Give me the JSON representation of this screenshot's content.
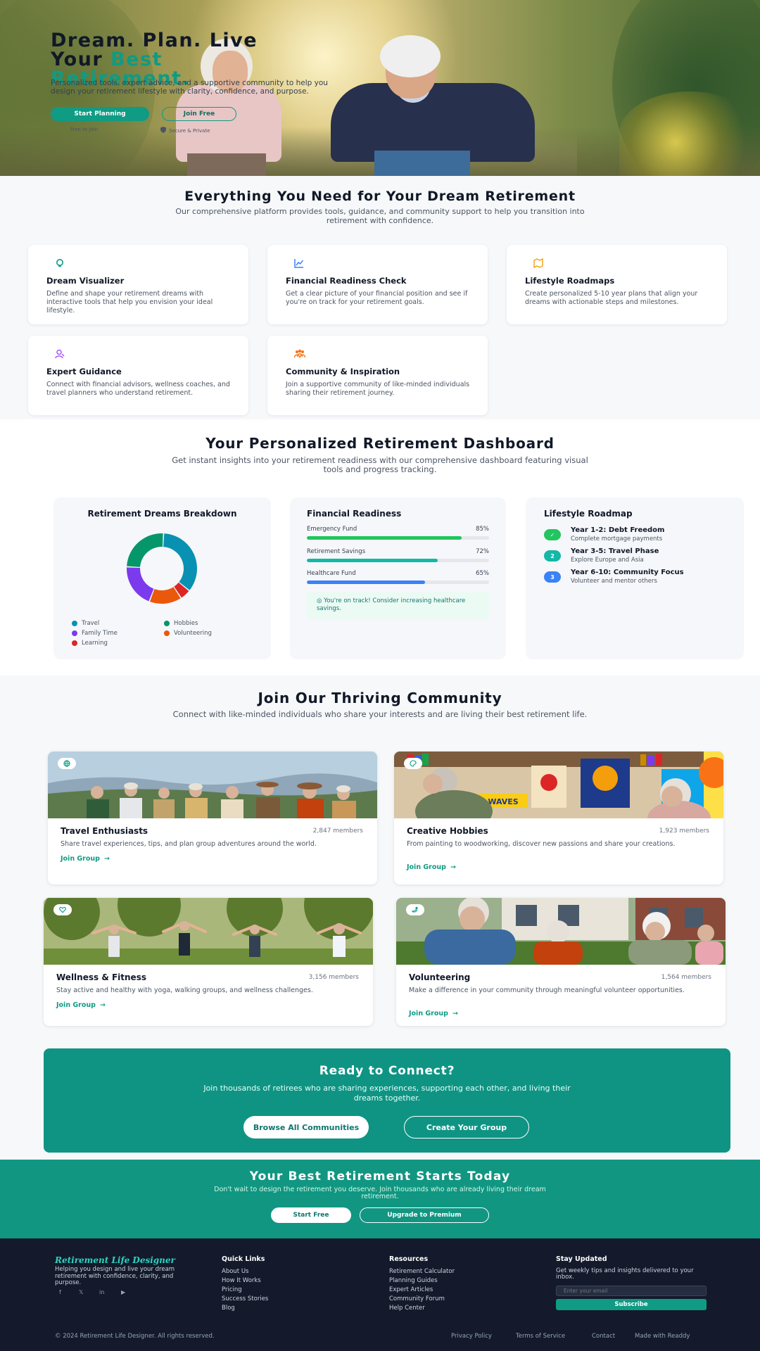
{
  "hero": {
    "title_line1": "Dream. Plan. Live",
    "title_line2_prefix": "Your ",
    "title_line2_accent": "Best",
    "title_line3_accent": "Retirement.",
    "subtitle": "Personalized tools, expert advice, and a supportive community to help you design your retirement lifestyle with clarity, confidence, and purpose.",
    "primary_button": "Start Planning",
    "secondary_button": "Join Free",
    "trust_left": "Free to Join",
    "trust_right": "Secure & Private",
    "colors": {
      "accent": "#0f9b84"
    }
  },
  "features": {
    "title": "Everything You Need for Your Dream Retirement",
    "subtitle": "Our comprehensive platform provides tools, guidance, and community support to help you transition into retirement with confidence.",
    "cards": [
      {
        "title": "Dream Visualizer",
        "desc": "Define and shape your retirement dreams with interactive tools that help you envision your ideal lifestyle.",
        "icon": "lightbulb-icon",
        "icon_color": "#0f9b84"
      },
      {
        "title": "Financial Readiness Check",
        "desc": "Get a clear picture of your financial position and see if you're on track for your retirement goals.",
        "icon": "chart-line-icon",
        "icon_color": "#3b82f6"
      },
      {
        "title": "Lifestyle Roadmaps",
        "desc": "Create personalized 5-10 year plans that align your dreams with actionable steps and milestones.",
        "icon": "map-icon",
        "icon_color": "#f59e0b"
      },
      {
        "title": "Expert Guidance",
        "desc": "Connect with financial advisors, wellness coaches, and travel planners who understand retirement.",
        "icon": "user-tie-icon",
        "icon_color": "#a855f7"
      },
      {
        "title": "Community & Inspiration",
        "desc": "Join a supportive community of like-minded individuals sharing their retirement journey.",
        "icon": "people-icon",
        "icon_color": "#f97316"
      }
    ]
  },
  "dashboard": {
    "title": "Your Personalized Retirement Dashboard",
    "subtitle": "Get instant insights into your retirement readiness with our comprehensive dashboard featuring visual tools and progress tracking.",
    "dreams_card": {
      "title": "Retirement Dreams Breakdown"
    },
    "finance_card": {
      "title": "Financial Readiness",
      "bars": [
        {
          "label": "Emergency Fund",
          "value": 85,
          "display": "85%",
          "color": "#22c55e"
        },
        {
          "label": "Retirement Savings",
          "value": 72,
          "display": "72%",
          "color": "#14b8a6"
        },
        {
          "label": "Healthcare Fund",
          "value": 65,
          "display": "65%",
          "color": "#3b82f6"
        }
      ],
      "status": "You're on track! Consider increasing healthcare savings."
    },
    "roadmap_card": {
      "title": "Lifestyle Roadmap",
      "items": [
        {
          "badge": "✓",
          "title": "Year 1-2: Debt Freedom",
          "sub": "Complete mortgage payments",
          "color": "#22c55e"
        },
        {
          "badge": "2",
          "title": "Year 3-5: Travel Phase",
          "sub": "Explore Europe and Asia",
          "color": "#14b8a6"
        },
        {
          "badge": "3",
          "title": "Year 6-10: Community Focus",
          "sub": "Volunteer and mentor others",
          "color": "#3b82f6"
        }
      ]
    }
  },
  "chart_data": {
    "type": "pie",
    "donut": true,
    "title": "Retirement Dreams Breakdown",
    "categories": [
      "Travel",
      "Learning",
      "Volunteering",
      "Family Time",
      "Hobbies"
    ],
    "values": [
      35,
      5,
      15,
      20,
      25
    ],
    "colors": [
      "#0891b2",
      "#dc2626",
      "#ea580c",
      "#7c3aed",
      "#059669"
    ],
    "legend": [
      {
        "label": "Travel",
        "color": "#0891b2"
      },
      {
        "label": "Hobbies",
        "color": "#059669"
      },
      {
        "label": "Family Time",
        "color": "#7c3aed"
      },
      {
        "label": "Volunteering",
        "color": "#ea580c"
      },
      {
        "label": "Learning",
        "color": "#dc2626"
      }
    ],
    "legend_position": "bottom"
  },
  "community": {
    "title": "Join Our Thriving Community",
    "subtitle": "Connect with like-minded individuals who share your interests and are living their best retirement life.",
    "join_label": "Join Group",
    "groups": [
      {
        "name": "Travel Enthusiasts",
        "members": "2,847 members",
        "desc": "Share travel experiences, tips, and plan group adventures around the world.",
        "icon": "globe-icon"
      },
      {
        "name": "Creative Hobbies",
        "members": "1,923 members",
        "desc": "From painting to woodworking, discover new passions and share your creations.",
        "icon": "palette-icon"
      },
      {
        "name": "Wellness & Fitness",
        "members": "3,156 members",
        "desc": "Stay active and healthy with yoga, walking groups, and wellness challenges.",
        "icon": "heart-icon"
      },
      {
        "name": "Volunteering",
        "members": "1,564 members",
        "desc": "Make a difference in your community through meaningful volunteer opportunities.",
        "icon": "hands-helping-icon"
      }
    ]
  },
  "cta": {
    "title": "Ready to Connect?",
    "subtitle": "Join thousands of retirees who are sharing experiences, supporting each other, and living their dreams together.",
    "primary": "Browse All Communities",
    "secondary": "Create Your Group"
  },
  "band": {
    "title": "Your Best Retirement Starts Today",
    "subtitle": "Don't wait to design the retirement you deserve. Join thousands who are already living their dream retirement.",
    "primary": "Start Free",
    "secondary": "Upgrade to Premium"
  },
  "footer": {
    "brand": "Retirement Life Designer",
    "tagline": "Helping you design and live your dream retirement with confidence, clarity, and purpose.",
    "social": [
      "f",
      "𝕏",
      "in",
      "▶"
    ],
    "quick_links": {
      "title": "Quick Links",
      "items": [
        "About Us",
        "How It Works",
        "Pricing",
        "Success Stories",
        "Blog"
      ]
    },
    "resources": {
      "title": "Resources",
      "items": [
        "Retirement Calculator",
        "Planning Guides",
        "Expert Articles",
        "Community Forum",
        "Help Center"
      ]
    },
    "newsletter": {
      "title": "Stay Updated",
      "desc": "Get weekly tips and insights delivered to your inbox.",
      "placeholder": "Enter your email",
      "button": "Subscribe"
    },
    "copyright": "© 2024 Retirement Life Designer. All rights reserved.",
    "bottom_links": [
      "Privacy Policy",
      "Terms of Service",
      "Contact",
      "Made with Readdy"
    ]
  }
}
